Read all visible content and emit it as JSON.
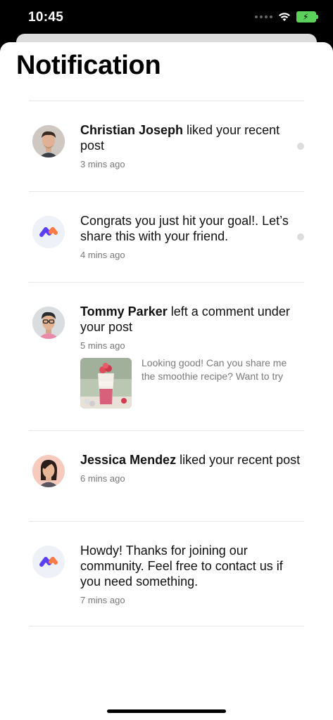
{
  "status_bar": {
    "time": "10:45"
  },
  "page": {
    "title": "Notification"
  },
  "notifications": [
    {
      "avatar": "christian-avatar",
      "name": "Christian Joseph",
      "text": " liked your recent post",
      "time": "3 mins ago",
      "unread": true
    },
    {
      "avatar": "app-logo-icon",
      "name": "",
      "text": "Congrats you just hit your goal!. Let’s share this with your friend.",
      "time": "4 mins ago",
      "unread": true
    },
    {
      "avatar": "tommy-avatar",
      "name": "Tommy Parker",
      "text": " left a comment under your post",
      "time": "5 mins ago",
      "comment": "Looking good! Can you share me the smoothie recipe? Want to try",
      "thumbnail": "smoothie-image"
    },
    {
      "avatar": "jessica-avatar",
      "name": "Jessica Mendez",
      "text": " liked your recent post",
      "time": "6 mins ago"
    },
    {
      "avatar": "app-logo-icon",
      "name": "",
      "text": "Howdy! Thanks for joining our community. Feel free to contact us if you need something.",
      "time": "7 mins ago"
    }
  ],
  "colors": {
    "logo_blue": "#5b3ff2",
    "logo_orange": "#ff7a45",
    "unread_dot": "#dcdcdc"
  }
}
